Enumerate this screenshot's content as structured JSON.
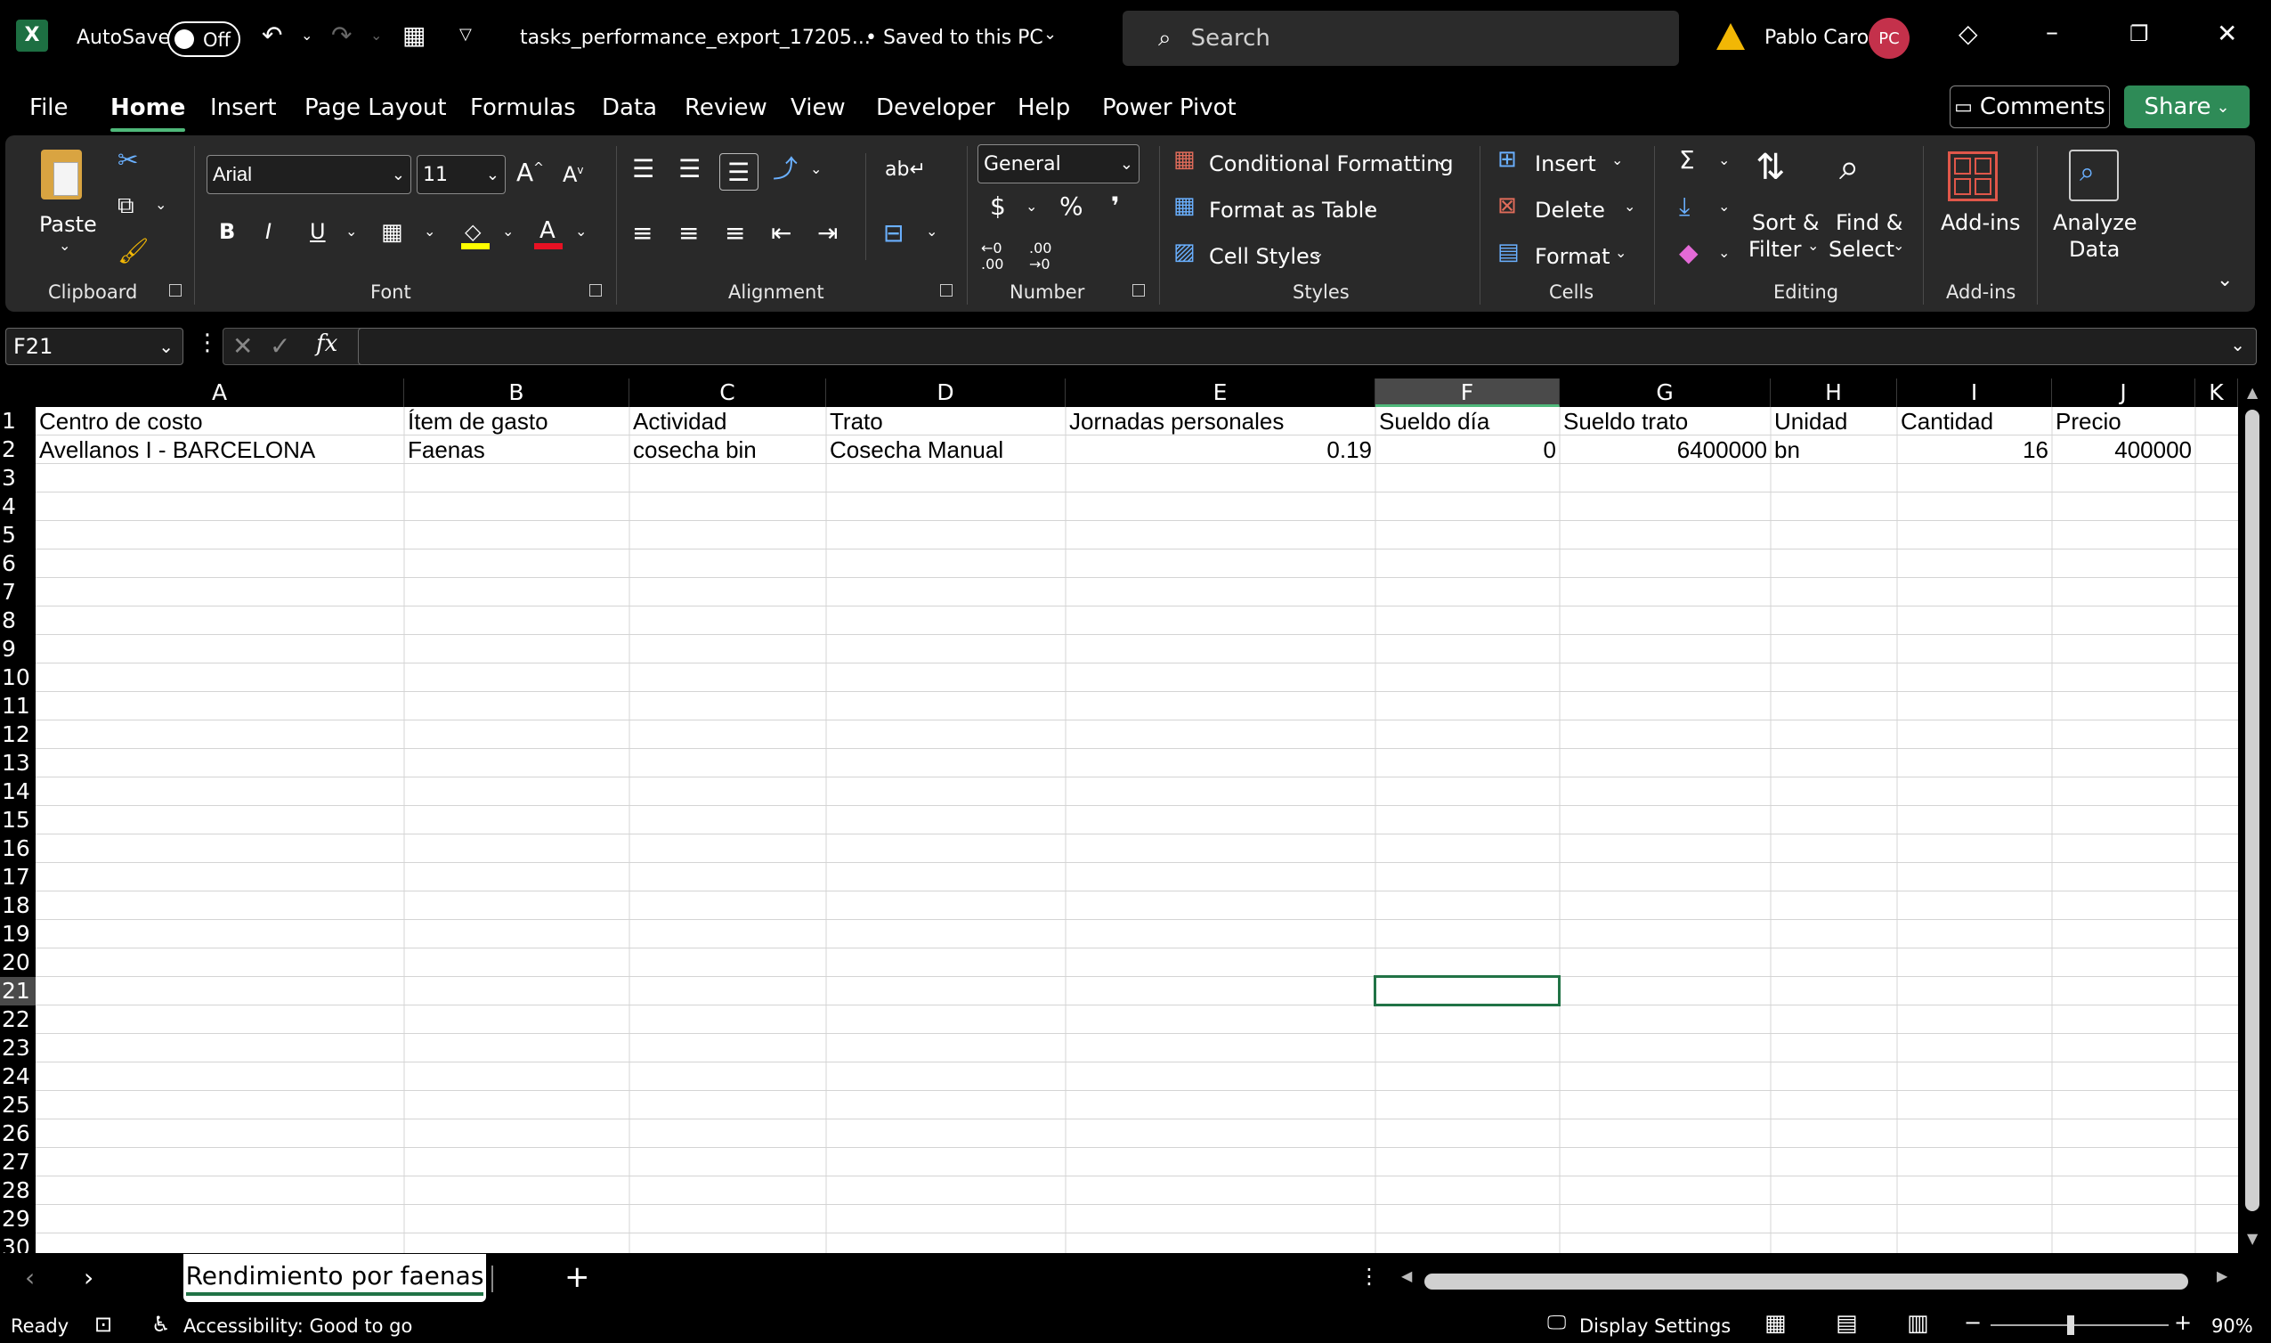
{
  "titlebar": {
    "autosave_label": "AutoSave",
    "autosave_state": "Off",
    "filename": "tasks_performance_export_17205...",
    "save_status": "• Saved to this PC",
    "search_placeholder": "Search",
    "user_name": "Pablo Caro",
    "user_initials": "PC"
  },
  "menu": {
    "tabs": [
      "File",
      "Home",
      "Insert",
      "Page Layout",
      "Formulas",
      "Data",
      "Review",
      "View",
      "Developer",
      "Help",
      "Power Pivot"
    ],
    "active": "Home",
    "comments_label": "Comments",
    "share_label": "Share"
  },
  "ribbon": {
    "clipboard": {
      "paste_label": "Paste",
      "group_label": "Clipboard"
    },
    "font": {
      "font_name": "Arial",
      "font_size": "11",
      "group_label": "Font"
    },
    "alignment": {
      "group_label": "Alignment"
    },
    "number": {
      "format": "General",
      "group_label": "Number",
      "decimal_inc": "←0\n.00",
      "decimal_dec": ".00\n→0"
    },
    "styles": {
      "conditional_formatting": "Conditional Formatting",
      "format_as_table": "Format as Table",
      "cell_styles": "Cell Styles",
      "group_label": "Styles"
    },
    "cells": {
      "insert": "Insert",
      "delete": "Delete",
      "format": "Format",
      "group_label": "Cells"
    },
    "editing": {
      "sort_filter_1": "Sort &",
      "sort_filter_2": "Filter",
      "find_select_1": "Find &",
      "find_select_2": "Select",
      "group_label": "Editing"
    },
    "addins": {
      "addins_label": "Add-ins",
      "group_label": "Add-ins"
    },
    "analyze": {
      "label_1": "Analyze",
      "label_2": "Data"
    }
  },
  "formula_bar": {
    "name_box": "F21",
    "formula": ""
  },
  "grid": {
    "columns": [
      "A",
      "B",
      "C",
      "D",
      "E",
      "F",
      "G",
      "H",
      "I",
      "J",
      "K"
    ],
    "selected_column": "F",
    "selected_row": "21",
    "rows": [
      "1",
      "2",
      "3",
      "4",
      "5",
      "6",
      "7",
      "8",
      "9",
      "10",
      "11",
      "12",
      "13",
      "14",
      "15",
      "16",
      "17",
      "18",
      "19",
      "20",
      "21",
      "22",
      "23",
      "24",
      "25",
      "26",
      "27",
      "28",
      "29",
      "30"
    ],
    "header_row": [
      "Centro de costo",
      "Ítem de gasto",
      "Actividad",
      "Trato",
      "Jornadas personales",
      "Sueldo día",
      "Sueldo trato",
      "Unidad",
      "Cantidad",
      "Precio"
    ],
    "data_row": [
      "Avellanos I - BARCELONA",
      "Faenas",
      "cosecha bin",
      "Cosecha Manual",
      "0.19",
      "0",
      "6400000",
      "bn",
      "16",
      "400000"
    ]
  },
  "sheet_tabs": {
    "active_tab": "Rendimiento por faenas",
    "add_label": "+"
  },
  "statusbar": {
    "ready": "Ready",
    "accessibility": "Accessibility: Good to go",
    "display_settings": "Display Settings",
    "zoom": "90%"
  },
  "colors": {
    "accent_green": "#217346",
    "tab_underline": "#4fb87a",
    "share_green": "#2e8b57",
    "avatar": "#c4314b"
  }
}
